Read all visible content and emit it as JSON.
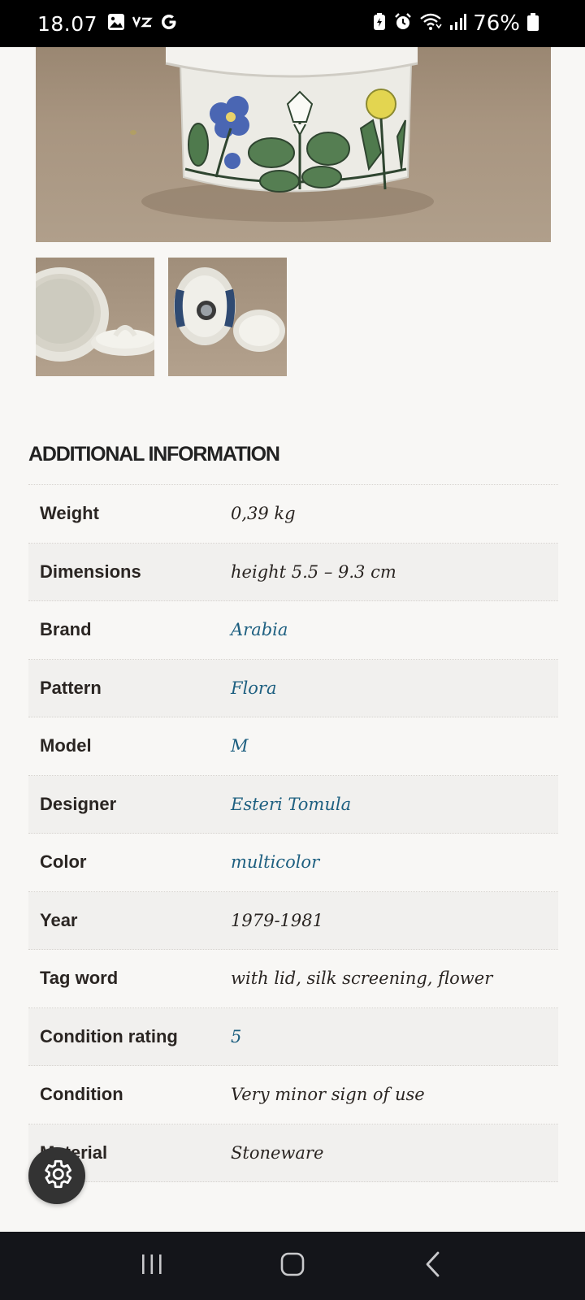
{
  "status_bar": {
    "time": "18.07",
    "battery_percent": "76%",
    "left_icons": [
      "gallery-icon",
      "voicemail-icon",
      "google-icon"
    ],
    "right_icons": [
      "battery-saver-icon",
      "alarm-icon",
      "wifi-icon",
      "signal-icon",
      "battery-icon"
    ]
  },
  "gallery": {
    "main_image": "Arabia Flora lidded jar with floral pattern",
    "thumbnails": [
      "open jar with lid",
      "jar bottom with stamp and lid"
    ]
  },
  "additional_info": {
    "title": "ADDITIONAL INFORMATION",
    "rows": [
      {
        "label": "Weight",
        "value": "0,39 kg",
        "is_link": false
      },
      {
        "label": "Dimensions",
        "value": "height 5.5 – 9.3 cm",
        "is_link": false
      },
      {
        "label": "Brand",
        "value": "Arabia",
        "is_link": true
      },
      {
        "label": "Pattern",
        "value": "Flora",
        "is_link": true
      },
      {
        "label": "Model",
        "value": "M",
        "is_link": true
      },
      {
        "label": "Designer",
        "value": "Esteri Tomula",
        "is_link": true
      },
      {
        "label": "Color",
        "value": "multicolor",
        "is_link": true
      },
      {
        "label": "Year",
        "value": "1979-1981",
        "is_link": false
      },
      {
        "label": "Tag word",
        "value": "with lid, silk screening, flower",
        "is_link": false
      },
      {
        "label": "Condition rating",
        "value": "5",
        "is_link": true
      },
      {
        "label": "Condition",
        "value": "Very minor sign of use",
        "is_link": false
      },
      {
        "label": "Material",
        "value": "Stoneware",
        "is_link": false
      }
    ]
  },
  "floating": {
    "icon": "gear-icon"
  },
  "nav_bar": {
    "buttons": [
      "recents",
      "home",
      "back"
    ]
  },
  "colors": {
    "link": "#1d5f80",
    "background": "#f8f7f5",
    "row_alt": "#f1f0ee",
    "navbar": "#14151a"
  }
}
